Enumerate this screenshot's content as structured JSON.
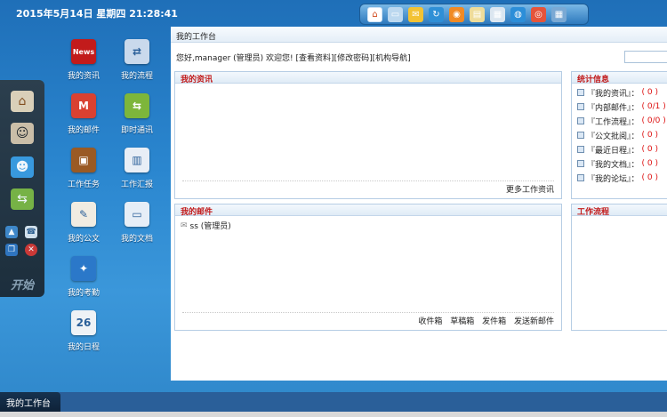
{
  "datetime": "2015年5月14日 星期四 21:28:41",
  "toolbar": [
    {
      "icon": "home-icon",
      "glyph": "⌂",
      "bg": "#ffffff"
    },
    {
      "icon": "window-icon",
      "glyph": "▭",
      "bg": "#bcd8ef"
    },
    {
      "icon": "mail-icon",
      "glyph": "✉",
      "bg": "#f3c233"
    },
    {
      "icon": "refresh-icon",
      "glyph": "↻",
      "bg": "#2f8fd6"
    },
    {
      "icon": "rss-icon",
      "glyph": "◉",
      "bg": "#f08a24"
    },
    {
      "icon": "notepad-icon",
      "glyph": "▤",
      "bg": "#eedc9a"
    },
    {
      "icon": "calendar-icon",
      "glyph": "▦",
      "bg": "#dbe6f0"
    },
    {
      "icon": "globe-icon",
      "glyph": "◍",
      "bg": "#2c8ed8"
    },
    {
      "icon": "lifebuoy-icon",
      "glyph": "◎",
      "bg": "#e5543a"
    },
    {
      "icon": "grid-icon",
      "glyph": "▦",
      "bg": "#7aa9d4"
    }
  ],
  "dock": {
    "start_label": "开始"
  },
  "desktop_icons": [
    {
      "name": "my-news",
      "label": "我的资讯",
      "glyph": "News",
      "bg": "#c21b1b"
    },
    {
      "name": "my-workflow",
      "label": "我的流程",
      "glyph": "⇄",
      "bg": "#c9d9ec"
    },
    {
      "name": "my-mail",
      "label": "我的邮件",
      "glyph": "M",
      "bg": "#d94131"
    },
    {
      "name": "instant-message",
      "label": "即时通讯",
      "glyph": "⇆",
      "bg": "#7db63b"
    },
    {
      "name": "work-tasks",
      "label": "工作任务",
      "glyph": "▣",
      "bg": "#9a5a24"
    },
    {
      "name": "work-report",
      "label": "工作汇报",
      "glyph": "▥",
      "bg": "#e8eef6"
    },
    {
      "name": "my-documents",
      "label": "我的公文",
      "glyph": "✎",
      "bg": "#f0ece2"
    },
    {
      "name": "my-files",
      "label": "我的文档",
      "glyph": "▭",
      "bg": "#e6eef7"
    },
    {
      "name": "my-attendance",
      "label": "我的考勤",
      "glyph": "✦",
      "bg": "#2b78c9"
    },
    {
      "name": "my-schedule",
      "label": "我的日程",
      "glyph": "26",
      "bg": "#eef2f6"
    }
  ],
  "window": {
    "title": "我的工作台",
    "greeting": "您好,manager (管理员) 欢迎您!",
    "links": [
      "[查看资料]",
      "[修改密码]",
      "[机构导航]"
    ]
  },
  "news_panel": {
    "title": "我的资讯",
    "footer": "更多工作资讯"
  },
  "mail_panel": {
    "title": "我的邮件",
    "items": [
      {
        "text": "ss (管理员)"
      }
    ],
    "footer": [
      "收件箱",
      "草稿箱",
      "发件箱",
      "发送新邮件"
    ]
  },
  "stats_panel": {
    "title": "统计信息",
    "rows": [
      {
        "label": "『我的资讯』：",
        "value": "( 0 )"
      },
      {
        "label": "『内部邮件』：",
        "value": "( 0/1 )"
      },
      {
        "label": "『工作流程』：",
        "value": "( 0/0 )"
      },
      {
        "label": "『公文批阅』：",
        "value": "( 0 )"
      },
      {
        "label": "『最近日程』：",
        "value": "( 0 )"
      },
      {
        "label": "『我的文档』：",
        "value": "( 0 )"
      },
      {
        "label": "『我的论坛』：",
        "value": "( 0 )"
      }
    ]
  },
  "workflow_panel": {
    "title": "工作流程"
  },
  "taskbar": {
    "active_task": "我的工作台"
  }
}
